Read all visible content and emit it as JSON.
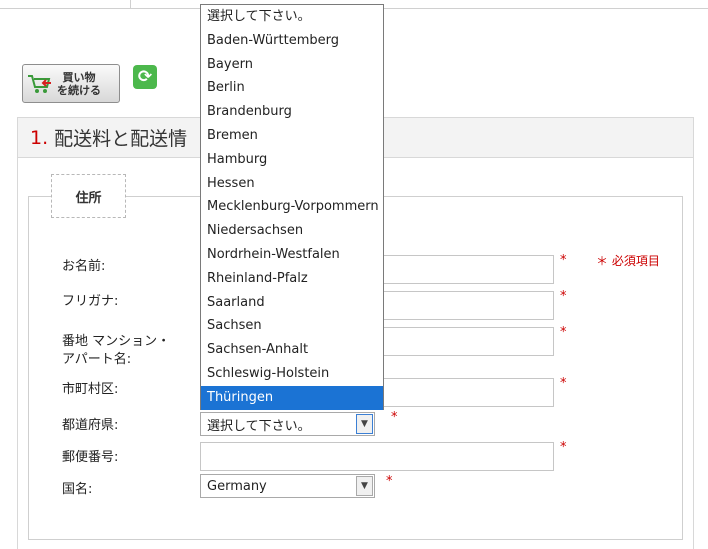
{
  "cart_button": {
    "label": "買い物\nを続ける"
  },
  "section": {
    "number": "1.",
    "title": "配送料と配送情"
  },
  "address_tab": {
    "label": "住所"
  },
  "required_note": "＊ 必須項目",
  "required_mark": "*",
  "fields": {
    "name": {
      "label": "お名前:",
      "value": ""
    },
    "furigana": {
      "label": "フリガナ:",
      "value": ""
    },
    "address": {
      "label": "番地 マンション・\nアパート名:",
      "value": ""
    },
    "city": {
      "label": "市町村区:",
      "value": ""
    },
    "prefecture": {
      "label": "都道府県:",
      "selected": "選択して下さい。"
    },
    "postal": {
      "label": "郵便番号:",
      "value": ""
    },
    "country": {
      "label": "国名:",
      "selected": "Germany"
    }
  },
  "prefecture_options": [
    "選択して下さい。",
    "Baden-Württemberg",
    "Bayern",
    "Berlin",
    "Brandenburg",
    "Bremen",
    "Hamburg",
    "Hessen",
    "Mecklenburg-Vorpommern",
    "Niedersachsen",
    "Nordrhein-Westfalen",
    "Rheinland-Pfalz",
    "Saarland",
    "Sachsen",
    "Sachsen-Anhalt",
    "Schleswig-Holstein",
    "Thüringen"
  ],
  "highlighted_option": "Thüringen",
  "colors": {
    "accent_red": "#cc0000",
    "highlight_blue": "#1b73d4",
    "refresh_green": "#4cb84c"
  }
}
